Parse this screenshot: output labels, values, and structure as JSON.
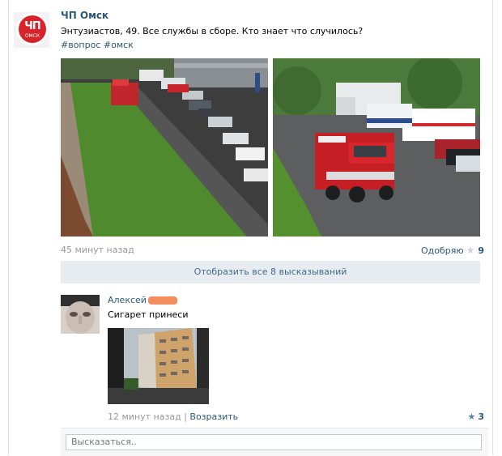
{
  "post": {
    "group_name": "ЧП Омск",
    "avatar_big": "ЧП",
    "avatar_small": "ОМСК",
    "text": "Энтузиастов, 49. Все службы в сборе. Кто знает что случилось?",
    "hashtags": "#вопрос #омск",
    "time": "45 минут назад",
    "like_label": "Одобряю",
    "like_count": "9",
    "show_all": "Отобразить все 8 высказываний"
  },
  "comment": {
    "author": "Алексей",
    "text": "Сигарет принеси",
    "time": "12 минут назад",
    "separator": "|",
    "reply_label": "Возразить",
    "like_count": "3"
  },
  "composer": {
    "placeholder": "Высказаться.."
  },
  "colors": {
    "link": "#2b587a",
    "muted": "#999999",
    "bar_bg": "#e7ecf1",
    "brand_red": "#d8232a"
  }
}
